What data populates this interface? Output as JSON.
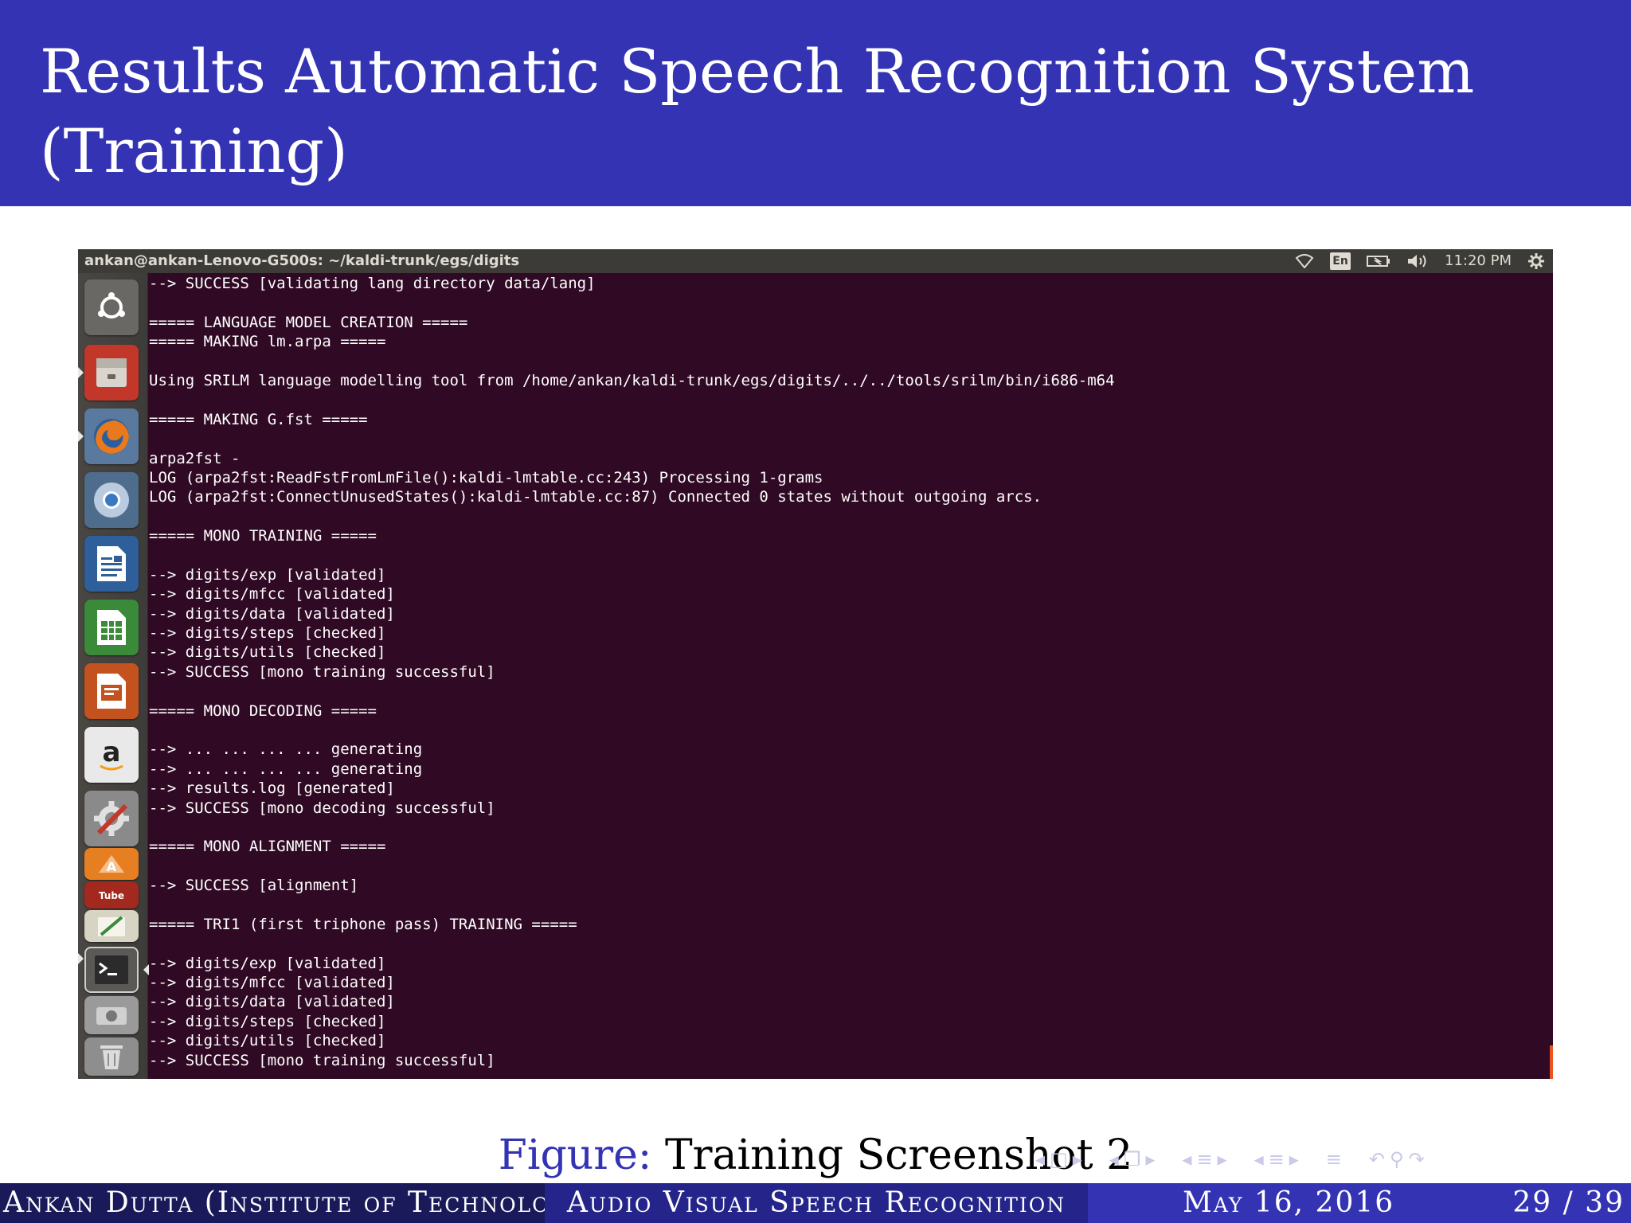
{
  "slide": {
    "title_line1": "Results Automatic Speech Recognition System",
    "title_line2": "(Training)"
  },
  "topbar": {
    "window_title": "ankan@ankan-Lenovo-G500s: ~/kaldi-trunk/egs/digits",
    "keyboard_layout": "En",
    "clock": "11:20 PM",
    "indicator_icons": [
      "wifi-icon",
      "keyboard-layout-icon",
      "battery-icon",
      "volume-icon",
      "gear-icon"
    ]
  },
  "launcher": {
    "items": [
      {
        "name": "dash-home-icon"
      },
      {
        "name": "files-icon"
      },
      {
        "name": "firefox-icon"
      },
      {
        "name": "chromium-icon"
      },
      {
        "name": "libreoffice-writer-icon"
      },
      {
        "name": "libreoffice-calc-icon"
      },
      {
        "name": "libreoffice-impress-icon"
      },
      {
        "name": "amazon-icon"
      },
      {
        "name": "system-settings-icon"
      },
      {
        "name": "ubuntu-software-center-icon"
      },
      {
        "name": "tube-icon"
      },
      {
        "name": "text-editor-icon"
      },
      {
        "name": "terminal-icon"
      },
      {
        "name": "disk-icon"
      },
      {
        "name": "trash-icon"
      }
    ]
  },
  "terminal": {
    "lines": [
      "--> SUCCESS [validating lang directory data/lang]",
      "",
      "===== LANGUAGE MODEL CREATION =====",
      "===== MAKING lm.arpa =====",
      "",
      "Using SRILM language modelling tool from /home/ankan/kaldi-trunk/egs/digits/../../tools/srilm/bin/i686-m64",
      "",
      "===== MAKING G.fst =====",
      "",
      "arpa2fst -",
      "LOG (arpa2fst:ReadFstFromLmFile():kaldi-lmtable.cc:243) Processing 1-grams",
      "LOG (arpa2fst:ConnectUnusedStates():kaldi-lmtable.cc:87) Connected 0 states without outgoing arcs.",
      "",
      "===== MONO TRAINING =====",
      "",
      "--> digits/exp [validated]",
      "--> digits/mfcc [validated]",
      "--> digits/data [validated]",
      "--> digits/steps [checked]",
      "--> digits/utils [checked]",
      "--> SUCCESS [mono training successful]",
      "",
      "===== MONO DECODING =====",
      "",
      "--> ... ... ... ... generating",
      "--> ... ... ... ... generating",
      "--> results.log [generated]",
      "--> SUCCESS [mono decoding successful]",
      "",
      "===== MONO ALIGNMENT =====",
      "",
      "--> SUCCESS [alignment]",
      "",
      "===== TRI1 (first triphone pass) TRAINING =====",
      "",
      "--> digits/exp [validated]",
      "--> digits/mfcc [validated]",
      "--> digits/data [validated]",
      "--> digits/steps [checked]",
      "--> digits/utils [checked]",
      "--> SUCCESS [mono training successful]"
    ]
  },
  "caption": {
    "label": "Figure:",
    "text": " Training Screenshot 2"
  },
  "footer": {
    "author": "Ankan Dutta (Institute of Technology",
    "title": "Audio Visual Speech Recognition",
    "date": "May 16, 2016",
    "page": "29 / 39"
  },
  "colors": {
    "header_blue": "#3333b3",
    "terminal_bg": "#300a24",
    "footer_dark": "#1a1a5a",
    "footer_mid": "#24248a",
    "footer_light": "#3333b3"
  }
}
